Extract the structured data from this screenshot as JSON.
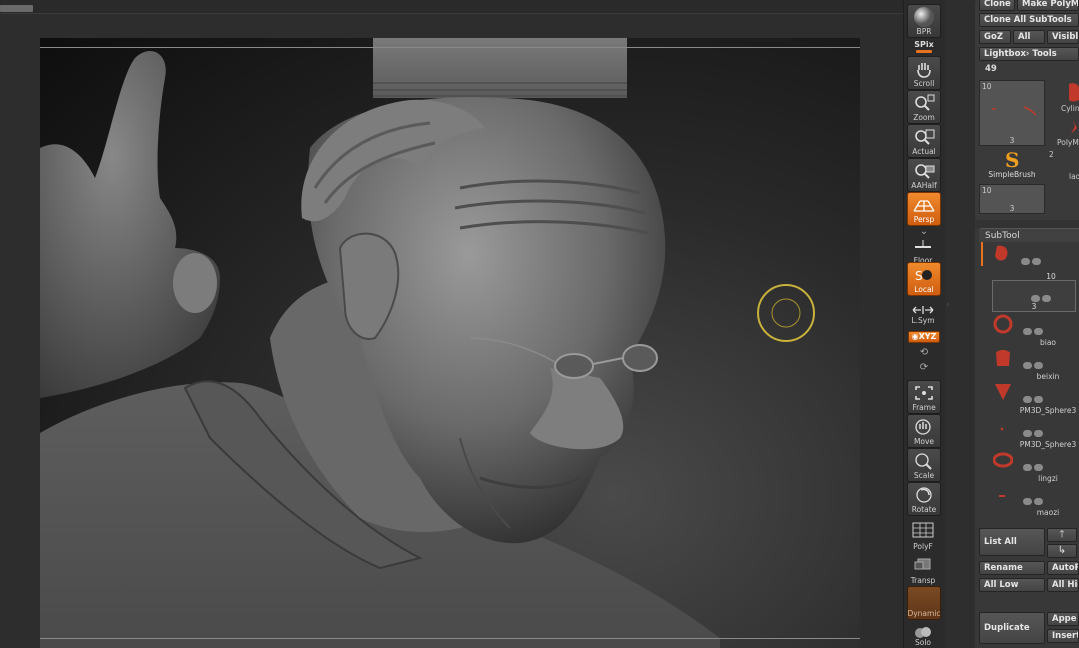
{
  "toolbar": {
    "bpr_label": "BPR",
    "spix_label": "SPix",
    "scroll_label": "Scroll",
    "zoom_label": "Zoom",
    "actual_label": "Actual",
    "aahalf_label": "AAHalf",
    "persp_label": "Persp",
    "floor_label": "Floor",
    "local_label": "Local",
    "lsym_label": "L.Sym",
    "xyz_label": "◉XYZ",
    "frame_label": "Frame",
    "move_label": "Move",
    "scale_label": "Scale",
    "rotate_label": "Rotate",
    "polyf_label": "PolyF",
    "transp_label": "Transp",
    "dynamic_label": "Dynamic",
    "solo_label": "Solo",
    "active": [
      "Persp",
      "Local",
      "XYZ",
      "Dynamic"
    ],
    "accent_color": "#e8731f"
  },
  "tool_panel": {
    "clone_label": "Clone",
    "make_polymesh_label": "Make PolyMe",
    "clone_all_subtools_label": "Clone All SubTools",
    "goz_label": "GoZ",
    "all_label": "All",
    "visible_label": "Visible",
    "lightbox_tools_label": "Lightbox› Tools",
    "tool_count": "49",
    "thumbs": [
      {
        "name": "current-tool",
        "count": "10",
        "sub": "3"
      },
      {
        "name": "Cylin",
        "count": "",
        "sub": ""
      },
      {
        "name": "PolyM",
        "count": "",
        "sub": ""
      },
      {
        "name": "SimpleBrush",
        "count": "",
        "sub": ""
      },
      {
        "name": "lao",
        "count": "2",
        "sub": ""
      },
      {
        "name": "lower-tool",
        "count": "10",
        "sub": "3"
      }
    ]
  },
  "subtool_panel": {
    "header": "SubTool",
    "items": [
      {
        "label": "",
        "slider": "10"
      },
      {
        "label": "",
        "slider": "3"
      },
      {
        "label": "biao",
        "slider": ""
      },
      {
        "label": "beixin",
        "slider": ""
      },
      {
        "label": "PM3D_Sphere3",
        "slider": ""
      },
      {
        "label": "PM3D_Sphere3",
        "slider": ""
      },
      {
        "label": "lingzi",
        "slider": ""
      },
      {
        "label": "maozi",
        "slider": ""
      }
    ],
    "list_all_label": "List All",
    "rename_label": "Rename",
    "autoreorder_label": "AutoR",
    "all_low_label": "All Low",
    "all_high_label": "All Hig",
    "duplicate_label": "Duplicate",
    "append_label": "Appe",
    "insert_label": "Insert",
    "icon_color": "#c0392b"
  }
}
